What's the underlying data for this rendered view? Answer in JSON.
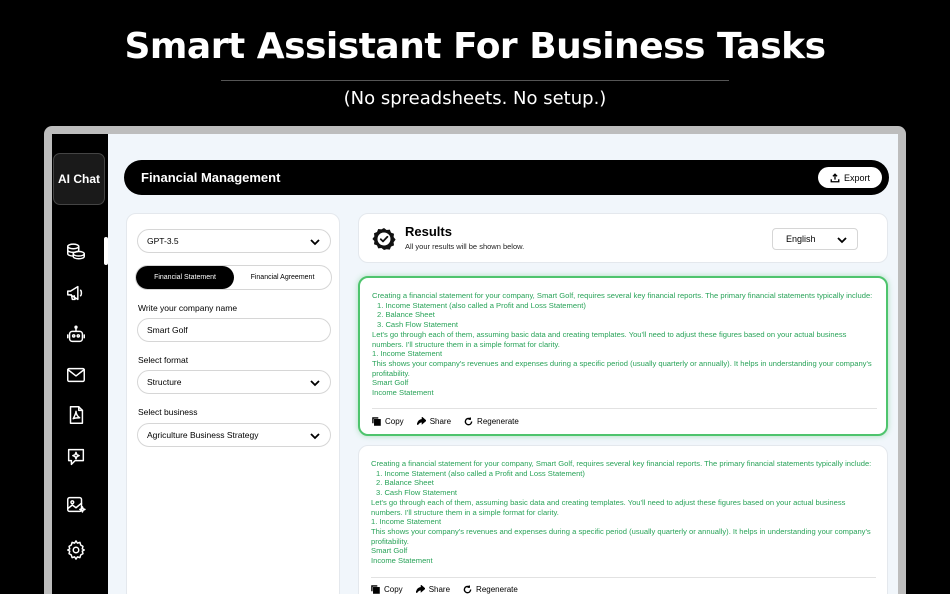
{
  "promo": {
    "headline": "Smart Assistant For Business Tasks",
    "subheadline": "(No spreadsheets. No setup.)"
  },
  "app": {
    "logo_text": "AI Chat",
    "sidebar_icons": [
      "coins-icon",
      "megaphone-icon",
      "robot-icon",
      "mail-icon",
      "pdf-file-icon",
      "chat-sparkle-icon",
      "image-sparkle-icon",
      "settings-icon"
    ],
    "topbar": {
      "title": "Financial Management",
      "export_label": "Export"
    },
    "left_panel": {
      "model": "GPT-3.5",
      "tabs": [
        {
          "label": "Financial Statement",
          "active": true
        },
        {
          "label": "Financial Agreement",
          "active": false
        }
      ],
      "company_label": "Write your company name",
      "company_value": "Smart Golf",
      "format_label": "Select format",
      "format_value": "Structure",
      "business_label": "Select business",
      "business_value": "Agriculture Business Strategy"
    },
    "results": {
      "title": "Results",
      "subtitle": "All your results will be shown below.",
      "language": "English"
    },
    "cards": [
      {
        "lines": [
          "Creating a financial statement for your company, Smart Golf, requires several key financial reports. The primary financial statements typically include:",
          "1.  Income Statement (also called a Profit and Loss Statement)",
          "2.  Balance Sheet",
          "3.  Cash Flow Statement",
          "Let's go through each of them, assuming basic data and creating templates. You'll need to adjust these figures based on your actual business",
          "numbers. I'll structure them in a simple format for clarity.",
          "1. Income Statement",
          "This shows your company's revenues and expenses during a specific period (usually quarterly or annually). It helps in understanding your company's",
          "profitability.",
          "Smart Golf",
          "Income Statement"
        ],
        "actions": {
          "copy": "Copy",
          "share": "Share",
          "regenerate": "Regenerate"
        }
      },
      {
        "lines": [
          "Creating a financial statement for your company, Smart Golf, requires several key financial reports. The primary financial statements typically include:",
          "1.  Income Statement (also called a Profit and Loss Statement)",
          "2.  Balance Sheet",
          "3.  Cash Flow Statement",
          "Let's go through each of them, assuming basic data and creating templates. You'll need to adjust these figures based on your actual business",
          "numbers. I'll structure them in a simple format for clarity.",
          "1. Income Statement",
          "This shows your company's revenues and expenses during a specific period (usually quarterly or annually). It helps in understanding your company's",
          "profitability.",
          "Smart Golf",
          "Income Statement"
        ],
        "actions": {
          "copy": "Copy",
          "share": "Share",
          "regenerate": "Regenerate"
        }
      }
    ],
    "colors": {
      "result_text": "#29a359",
      "highlight_border": "#4ec46d",
      "background": "#f1f6fb"
    }
  }
}
